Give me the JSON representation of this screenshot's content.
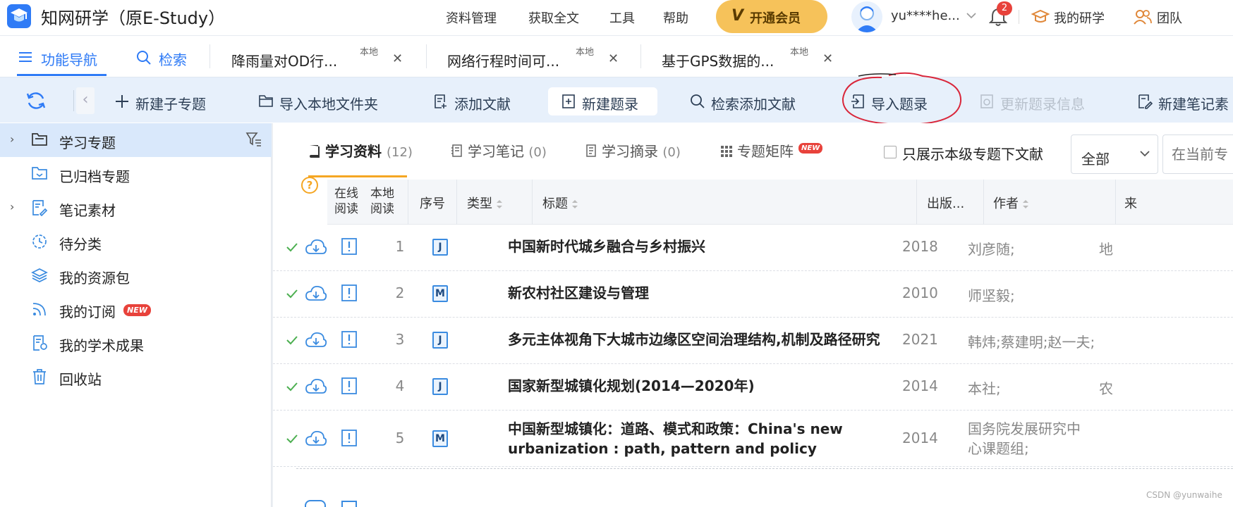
{
  "header": {
    "app_title": "知网研学（原E-Study）",
    "menu": [
      "资料管理",
      "获取全文",
      "工具",
      "帮助"
    ],
    "vip_label": "开通会员",
    "vip_icon": "V",
    "username": "yu****he...",
    "notification_count": "2",
    "links": [
      "我的研学",
      "团队"
    ]
  },
  "tabs": {
    "nav": "功能导航",
    "search": "检索",
    "docs": [
      {
        "title": "降雨量对OD行...",
        "tag": "本地"
      },
      {
        "title": "网络行程时间可...",
        "tag": "本地"
      },
      {
        "title": "基于GPS数据的...",
        "tag": "本地"
      }
    ]
  },
  "toolbar": {
    "items": [
      "新建子专题",
      "导入本地文件夹",
      "添加文献",
      "新建题录",
      "检索添加文献",
      "导入题录",
      "更新题录信息",
      "新建笔记素"
    ]
  },
  "sidebar": {
    "items": [
      {
        "label": "学习专题"
      },
      {
        "label": "已归档专题"
      },
      {
        "label": "笔记素材"
      },
      {
        "label": "待分类"
      },
      {
        "label": "我的资源包"
      },
      {
        "label": "我的订阅",
        "badge": "NEW"
      },
      {
        "label": "我的学术成果"
      },
      {
        "label": "回收站"
      }
    ]
  },
  "content_tabs": [
    {
      "label": "学习资料",
      "count": "(12)"
    },
    {
      "label": "学习笔记",
      "count": "(0)"
    },
    {
      "label": "学习摘录",
      "count": "(0)"
    },
    {
      "label": "专题矩阵",
      "count": ""
    }
  ],
  "matrix_badge": "NEW",
  "filter": {
    "checkbox_label": "只展示本级专题下文献",
    "select_value": "全部",
    "search_placeholder": "在当前专"
  },
  "help_symbol": "?",
  "table": {
    "headers": {
      "online_read_1": "在线",
      "online_read_2": "阅读",
      "local_read_1": "本地",
      "local_read_2": "阅读",
      "seq": "序号",
      "type": "类型",
      "title": "标题",
      "year": "出版...",
      "author": "作者",
      "source": "来"
    },
    "rows": [
      {
        "seq": "1",
        "type": "J",
        "title": "中国新时代城乡融合与乡村振兴",
        "year": "2018",
        "author": "刘彦随;",
        "source": "地"
      },
      {
        "seq": "2",
        "type": "M",
        "title": "新农村社区建设与管理",
        "year": "2010",
        "author": "师坚毅;",
        "source": ""
      },
      {
        "seq": "3",
        "type": "J",
        "title": "多元主体视角下大城市边缘区空间治理结构,机制及路径研究",
        "year": "2021",
        "author": "韩炜;蔡建明;赵一夫;",
        "source": ""
      },
      {
        "seq": "4",
        "type": "J",
        "title": "国家新型城镇化规划(2014—2020年)",
        "year": "2014",
        "author": "本社;",
        "source": "农"
      },
      {
        "seq": "5",
        "type": "M",
        "title": "中国新型城镇化：道路、模式和政策：China's new urbanization : path, pattern and policy",
        "year": "2014",
        "author": "国务院发展研究中心课题组;",
        "source": ""
      }
    ]
  },
  "watermark": "CSDN @yunwaihe",
  "colors": {
    "primary": "#2f7bf6",
    "toolbar_bg": "#e7f0fb",
    "vip": "#f6c25a",
    "accent_underline": "#f5a623",
    "badge_red": "#e8423b",
    "check_green": "#4caf50"
  }
}
